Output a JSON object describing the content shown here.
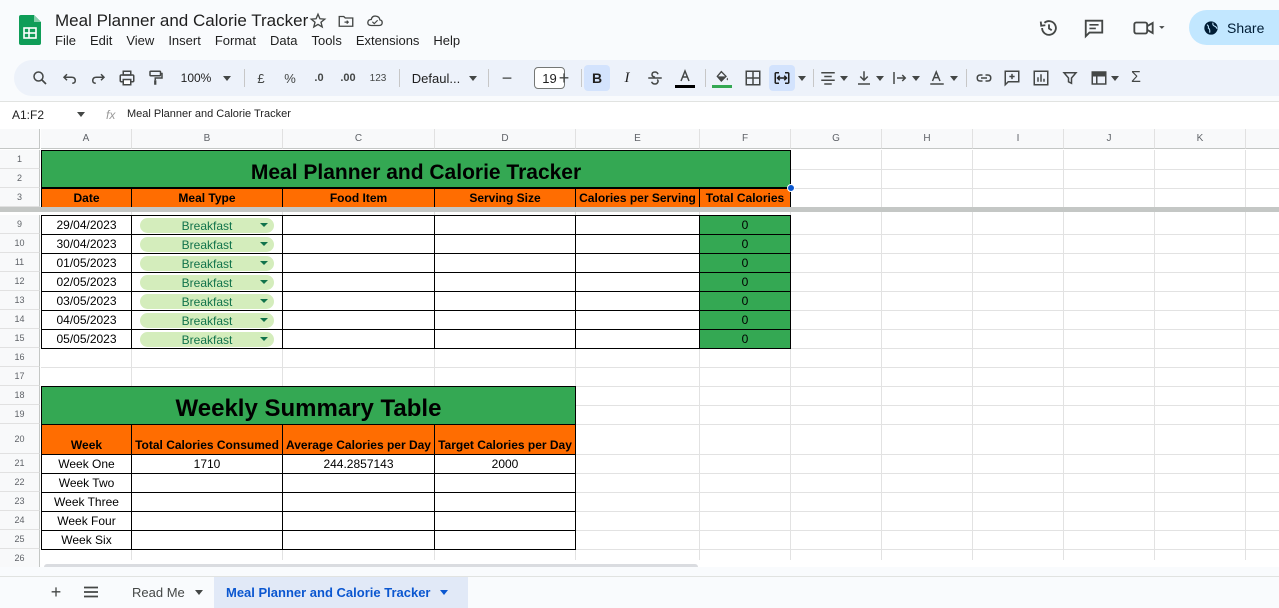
{
  "app": {
    "doc_title": "Meal Planner and Calorie Tracker",
    "menus": [
      "File",
      "Edit",
      "View",
      "Insert",
      "Format",
      "Data",
      "Tools",
      "Extensions",
      "Help"
    ],
    "share_label": "Share"
  },
  "toolbar": {
    "zoom": "100%",
    "currency": "£",
    "percent": "%",
    "dec_decrease": ".0",
    "dec_increase": ".00",
    "number_format": "123",
    "font": "Defaul...",
    "font_size": "19",
    "bold": "B",
    "italic": "I"
  },
  "formula_bar": {
    "name_box": "A1:F2",
    "fx": "fx",
    "content": "Meal Planner and Calorie Tracker"
  },
  "columns": [
    "A",
    "B",
    "C",
    "D",
    "E",
    "F",
    "G",
    "H",
    "I",
    "J",
    "K"
  ],
  "rows_top": [
    "1",
    "2",
    "3"
  ],
  "rows_main": [
    "9",
    "10",
    "11",
    "12",
    "13",
    "14",
    "15",
    "16",
    "17",
    "18",
    "19",
    "20",
    "21",
    "22",
    "23",
    "24",
    "25",
    "26"
  ],
  "tracker": {
    "title": "Meal Planner and Calorie Tracker",
    "headers": [
      "Date",
      "Meal Type",
      "Food Item",
      "Serving Size",
      "Calories per Serving",
      "Total Calories"
    ],
    "rows": [
      {
        "date": "29/04/2023",
        "meal": "Breakfast",
        "total": "0"
      },
      {
        "date": "30/04/2023",
        "meal": "Breakfast",
        "total": "0"
      },
      {
        "date": "01/05/2023",
        "meal": "Breakfast",
        "total": "0"
      },
      {
        "date": "02/05/2023",
        "meal": "Breakfast",
        "total": "0"
      },
      {
        "date": "03/05/2023",
        "meal": "Breakfast",
        "total": "0"
      },
      {
        "date": "04/05/2023",
        "meal": "Breakfast",
        "total": "0"
      },
      {
        "date": "05/05/2023",
        "meal": "Breakfast",
        "total": "0"
      }
    ]
  },
  "summary": {
    "title": "Weekly Summary Table",
    "headers": [
      "Week",
      "Total Calories Consumed",
      "Average Calories per Day",
      "Target Calories per Day"
    ],
    "rows": [
      {
        "week": "Week One",
        "total": "1710",
        "avg": "244.2857143",
        "target": "2000"
      },
      {
        "week": "Week Two",
        "total": "",
        "avg": "",
        "target": ""
      },
      {
        "week": "Week Three",
        "total": "",
        "avg": "",
        "target": ""
      },
      {
        "week": "Week Four",
        "total": "",
        "avg": "",
        "target": ""
      },
      {
        "week": "Week Six",
        "total": "",
        "avg": "",
        "target": ""
      }
    ]
  },
  "sheets": {
    "tabs": [
      {
        "label": "Read Me",
        "active": false
      },
      {
        "label": "Meal Planner and Calorie Tracker",
        "active": true
      }
    ]
  },
  "colors": {
    "green": "#34a853",
    "orange": "#ff6d01",
    "chip_bg": "#d4edbc",
    "chip_text": "#11734b",
    "accent": "#0b57d0"
  }
}
